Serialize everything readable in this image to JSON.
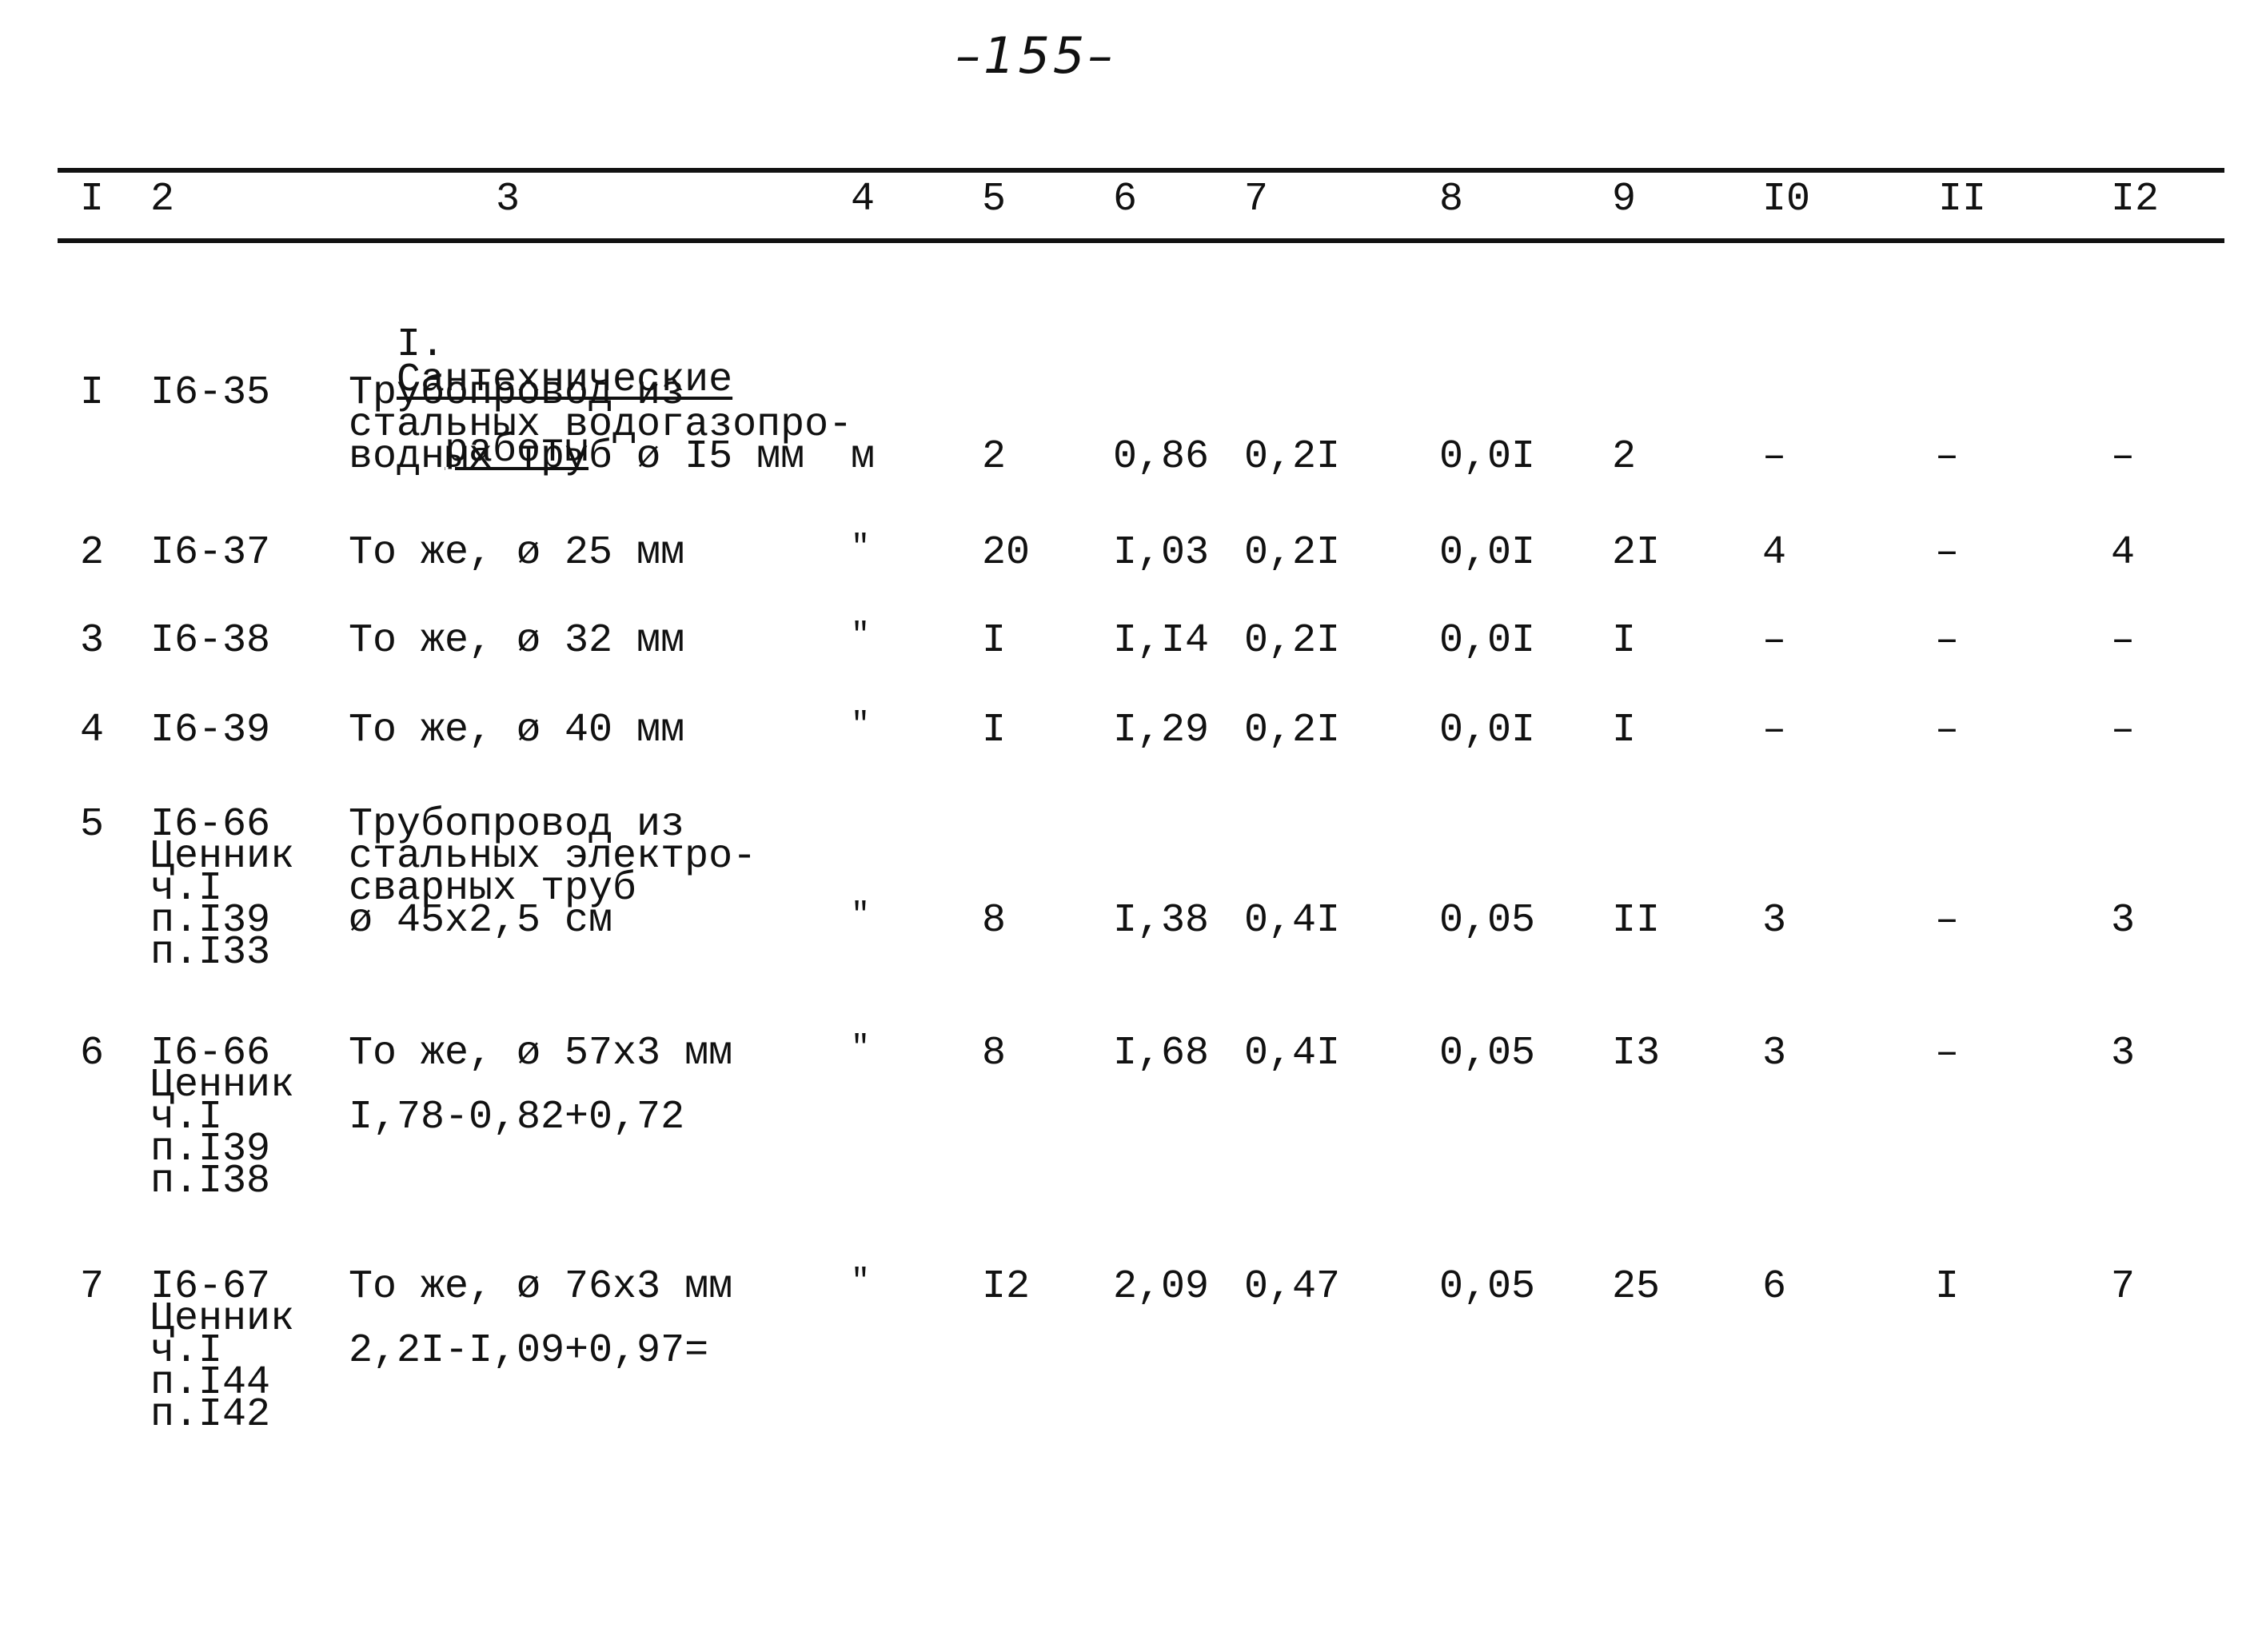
{
  "page_number": "–155–",
  "columns": [
    "I",
    "2",
    "3",
    "4",
    "5",
    "6",
    "7",
    "8",
    "9",
    "I0",
    "II",
    "I2"
  ],
  "section": {
    "number": "I.",
    "title_line1": "Сантехнические",
    "title_line2": "работы"
  },
  "rows": [
    {
      "n": "I",
      "code_lines": [
        "I6-35"
      ],
      "desc_lines": [
        "Трубопровод из",
        "стальных водогазопро-",
        "водных труб ø I5 мм"
      ],
      "calc": "",
      "unit": "м",
      "c5": "2",
      "c6": "0,86",
      "c7": "0,2I",
      "c8": "0,0I",
      "c9": "2",
      "c10": "–",
      "c11": "–",
      "c12": "–"
    },
    {
      "n": "2",
      "code_lines": [
        "I6-37"
      ],
      "desc_lines": [
        "То же, ø 25 мм"
      ],
      "calc": "",
      "unit": "\"",
      "c5": "20",
      "c6": "I,03",
      "c7": "0,2I",
      "c8": "0,0I",
      "c9": "2I",
      "c10": "4",
      "c11": "–",
      "c12": "4"
    },
    {
      "n": "3",
      "code_lines": [
        "I6-38"
      ],
      "desc_lines": [
        "То же, ø 32 мм"
      ],
      "calc": "",
      "unit": "\"",
      "c5": "I",
      "c6": "I,I4",
      "c7": "0,2I",
      "c8": "0,0I",
      "c9": "I",
      "c10": "–",
      "c11": "–",
      "c12": "–"
    },
    {
      "n": "4",
      "code_lines": [
        "I6-39"
      ],
      "desc_lines": [
        "То же, ø 40 мм"
      ],
      "calc": "",
      "unit": "\"",
      "c5": "I",
      "c6": "I,29",
      "c7": "0,2I",
      "c8": "0,0I",
      "c9": "I",
      "c10": "–",
      "c11": "–",
      "c12": "–"
    },
    {
      "n": "5",
      "code_lines": [
        "I6-66",
        "Ценник",
        "ч.I",
        "п.I39",
        "п.I33"
      ],
      "desc_lines": [
        "Трубопровод из",
        "стальных электро-",
        "сварных труб",
        "ø 45x2,5 см"
      ],
      "calc": "",
      "unit": "\"",
      "c5": "8",
      "c6": "I,38",
      "c7": "0,4I",
      "c8": "0,05",
      "c9": "II",
      "c10": "3",
      "c11": "–",
      "c12": "3"
    },
    {
      "n": "6",
      "code_lines": [
        "I6-66",
        "Ценник",
        "ч.I",
        "п.I39",
        "п.I38"
      ],
      "desc_lines": [
        "То же, ø 57x3 мм"
      ],
      "calc": "I,78-0,82+0,72",
      "unit": "\"",
      "c5": "8",
      "c6": "I,68",
      "c7": "0,4I",
      "c8": "0,05",
      "c9": "I3",
      "c10": "3",
      "c11": "–",
      "c12": "3"
    },
    {
      "n": "7",
      "code_lines": [
        "I6-67",
        "Ценник",
        "ч.I",
        "п.I44",
        "п.I42"
      ],
      "desc_lines": [
        "То же, ø 76x3 мм"
      ],
      "calc": "2,2I-I,09+0,97=",
      "unit": "\"",
      "c5": "I2",
      "c6": "2,09",
      "c7": "0,47",
      "c8": "0,05",
      "c9": "25",
      "c10": "6",
      "c11": "I",
      "c12": "7"
    }
  ]
}
